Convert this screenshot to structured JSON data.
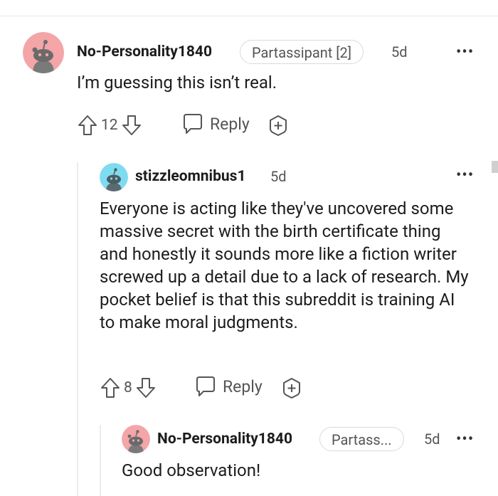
{
  "comments": [
    {
      "username": "No-Personality1840",
      "flair": "Partassipant [2]",
      "age": "5d",
      "text": "I’m guessing this isn’t real.",
      "upvotes": "12",
      "reply_label": "Reply",
      "avatar_color": "#f4a5a8"
    },
    {
      "username": "stizzleomnibus1",
      "age": "5d",
      "text": "Everyone is acting like they've uncovered some massive secret with the birth certificate thing and honestly it sounds more like a fiction writer screwed up a detail due to a lack of research. My pocket belief is that this subreddit is training AI to make moral judgments.",
      "upvotes": "8",
      "reply_label": "Reply",
      "avatar_color": "#7fdcf0"
    },
    {
      "username": "No-Personality1840",
      "flair": "Partass...",
      "age": "5d",
      "text": "Good observation!",
      "avatar_color": "#f4a5a8"
    }
  ],
  "more_glyph": "•••"
}
